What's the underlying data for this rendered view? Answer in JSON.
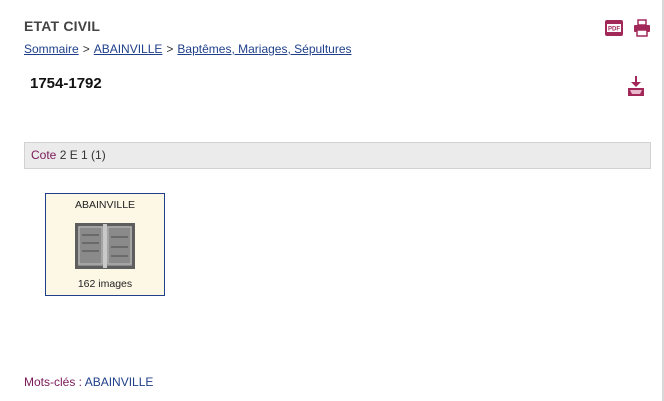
{
  "header": {
    "title": "ETAT CIVIL",
    "pdf_icon_text": "PDF"
  },
  "breadcrumb": {
    "items": [
      "Sommaire",
      "ABAINVILLE",
      "Baptêmes, Mariages, Sépultures"
    ],
    "separator": ">"
  },
  "main": {
    "subtitle": "1754-1792"
  },
  "cote": {
    "label": "Cote",
    "value": "2 E 1 (1)"
  },
  "card": {
    "title": "ABAINVILLE",
    "count": "162 images"
  },
  "keywords": {
    "label": "Mots-clés :",
    "value": "ABAINVILLE"
  },
  "colors": {
    "accent": "#a3285a",
    "link": "#1f3f8a",
    "label": "#7a1858"
  }
}
